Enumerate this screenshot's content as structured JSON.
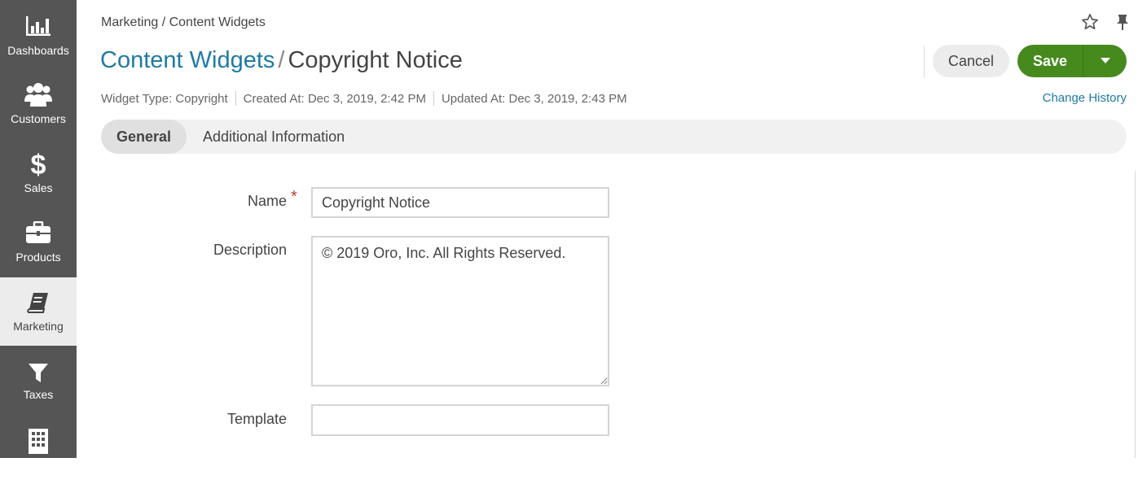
{
  "sidebar": {
    "items": [
      {
        "label": "Dashboards",
        "icon": "bar-chart-icon"
      },
      {
        "label": "Customers",
        "icon": "users-icon"
      },
      {
        "label": "Sales",
        "icon": "dollar-icon"
      },
      {
        "label": "Products",
        "icon": "briefcase-icon"
      },
      {
        "label": "Marketing",
        "icon": "book-icon"
      },
      {
        "label": "Taxes",
        "icon": "filter-icon"
      },
      {
        "label": "",
        "icon": "building-icon"
      }
    ],
    "active": "Marketing"
  },
  "header": {
    "breadcrumb": "Marketing / Content Widgets",
    "title_link": "Content Widgets",
    "title_separator": "/",
    "title_current": "Copyright Notice",
    "cancel_label": "Cancel",
    "save_label": "Save"
  },
  "meta": {
    "widget_type": "Widget Type: Copyright",
    "created_at": "Created At: Dec 3, 2019, 2:42 PM",
    "updated_at": "Updated At: Dec 3, 2019, 2:43 PM",
    "change_history": "Change History"
  },
  "tabs": [
    {
      "label": "General",
      "active": true
    },
    {
      "label": "Additional Information",
      "active": false
    }
  ],
  "form": {
    "name_label": "Name",
    "name_required_marker": "*",
    "name_value": "Copyright Notice",
    "description_label": "Description",
    "description_value": "© 2019 Oro, Inc. All Rights Reserved.",
    "template_label": "Template",
    "template_value": ""
  },
  "colors": {
    "sidebar": "#555555",
    "accent_link": "#1f7aa3",
    "save_green": "#468a1e",
    "required": "#c0392b"
  }
}
